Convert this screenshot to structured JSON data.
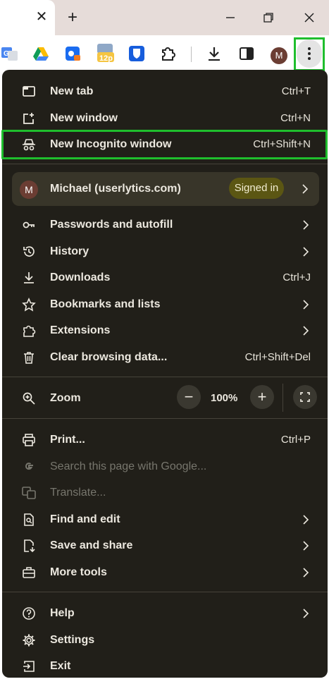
{
  "tabbar": {
    "close_glyph": "✕",
    "new_tab_glyph": "+"
  },
  "toolbar": {
    "extensions": [
      "google-translate-icon",
      "google-drive-icon",
      "extension-blue-icon",
      "calendar-12p-icon",
      "bitwarden-icon",
      "extensions-puzzle-icon"
    ],
    "calendar_badge": "12p",
    "avatar_letter": "M"
  },
  "menu": {
    "new_tab": {
      "label": "New tab",
      "shortcut": "Ctrl+T"
    },
    "new_window": {
      "label": "New window",
      "shortcut": "Ctrl+N"
    },
    "new_incognito": {
      "label": "New Incognito window",
      "shortcut": "Ctrl+Shift+N"
    },
    "profile": {
      "avatar_letter": "M",
      "name": "Michael (userlytics.com)",
      "status": "Signed in"
    },
    "passwords": {
      "label": "Passwords and autofill"
    },
    "history": {
      "label": "History"
    },
    "downloads": {
      "label": "Downloads",
      "shortcut": "Ctrl+J"
    },
    "bookmarks": {
      "label": "Bookmarks and lists"
    },
    "extensions": {
      "label": "Extensions"
    },
    "clear_data": {
      "label": "Clear browsing data...",
      "shortcut": "Ctrl+Shift+Del"
    },
    "zoom": {
      "label": "Zoom",
      "minus": "−",
      "value": "100%",
      "plus": "+"
    },
    "print": {
      "label": "Print...",
      "shortcut": "Ctrl+P"
    },
    "search_page": {
      "label": "Search this page with Google..."
    },
    "translate": {
      "label": "Translate..."
    },
    "find_edit": {
      "label": "Find and edit"
    },
    "save_share": {
      "label": "Save and share"
    },
    "more_tools": {
      "label": "More tools"
    },
    "help": {
      "label": "Help"
    },
    "settings": {
      "label": "Settings"
    },
    "exit": {
      "label": "Exit"
    }
  },
  "colors": {
    "menu_bg": "#211f19",
    "highlight": "#1fbe2d",
    "signed_in_bg": "#5b5613",
    "profile_bg": "#383529"
  }
}
